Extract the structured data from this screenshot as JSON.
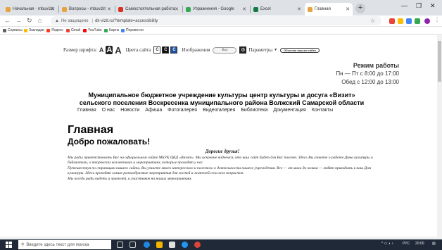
{
  "browser": {
    "tabs": [
      {
        "label": "Начальная · mbuvizit",
        "favicon": "#e8a33d",
        "active": false
      },
      {
        "label": "Вопросы - mbuvizit",
        "favicon": "#e8a33d",
        "active": false
      },
      {
        "label": "Самостоятельная работа",
        "favicon": "#d93025",
        "active": false
      },
      {
        "label": "Упражнения - Google",
        "favicon": "#34a853",
        "active": false
      },
      {
        "label": "Excel",
        "favicon": "#107c41",
        "active": false
      },
      {
        "label": "Главная",
        "favicon": "#e8a33d",
        "active": true
      }
    ],
    "url": "dk-vizit.ru/?template=accessibility",
    "security_label": "Не защищено",
    "bookmarks": [
      "Сервисы",
      "Закладки",
      "Яндекс",
      "Gmail",
      "YouTube",
      "Карты",
      "Перевести"
    ]
  },
  "accessibility_panel": {
    "font_size_label": "Размер шрифта:",
    "font_size_options": [
      "A",
      "A",
      "A"
    ],
    "color_label": "Цвета сайта",
    "color_options": [
      "C",
      "C",
      "C"
    ],
    "images_label": "Изображения",
    "images_toggle": "Вкл",
    "settings_label": "Параметры",
    "normal_version_label": "Обычная версия сайта"
  },
  "hours": {
    "title": "Режим работы",
    "weekdays": "Пн — Пт  с 8:00 до 17:00",
    "lunch": "Обед  с 12:00 до 13:00"
  },
  "organization": {
    "line1": "Муниципальное бюджетное учреждение культуры центр культуры и досуга «Визит»",
    "line2": "сельского поселения Воскресенка муниципального района Волжский Самарской области"
  },
  "nav": [
    "Главная",
    "О нас",
    "Новости",
    "Афиша",
    "Фотогалерея",
    "Видеогалерея",
    "Библиотека",
    "Документация",
    "Контакты"
  ],
  "main": {
    "page_title": "Главная",
    "welcome": "Добро пожаловать!",
    "greeting_title": "Дорогие друзья!",
    "paragraphs": [
      "Мы рады приветствовать Вас на официальном сайте МБУК ЦКД «Визит». Мы искренне надеемся, что наш сайт будет для Вас полезен. Здесь Вы узнаете о работе Дома культуры и библиотеки, о творческих коллективах и мероприятиях, которые проходят у нас.",
      "Путешествуя по страницам нашего сайта, Вы узнаете много интересного и полезного о деятельности нашего учреждения. Все — от мала до велика — любят приходить в наш Дом культуры. Здесь проходят самые разнообразные мероприятия для гостей и жителей села всех возрастов.",
      "Мы всегда рады видеть и зрителей, и участников на наших мероприятиях."
    ]
  },
  "taskbar": {
    "search_placeholder": "Введите здесь текст для поиска",
    "tray_lang": "РУС",
    "clock": "20:00"
  },
  "colors": {
    "tabstrip": "#dee1e6",
    "taskbar": "#1f2937"
  }
}
